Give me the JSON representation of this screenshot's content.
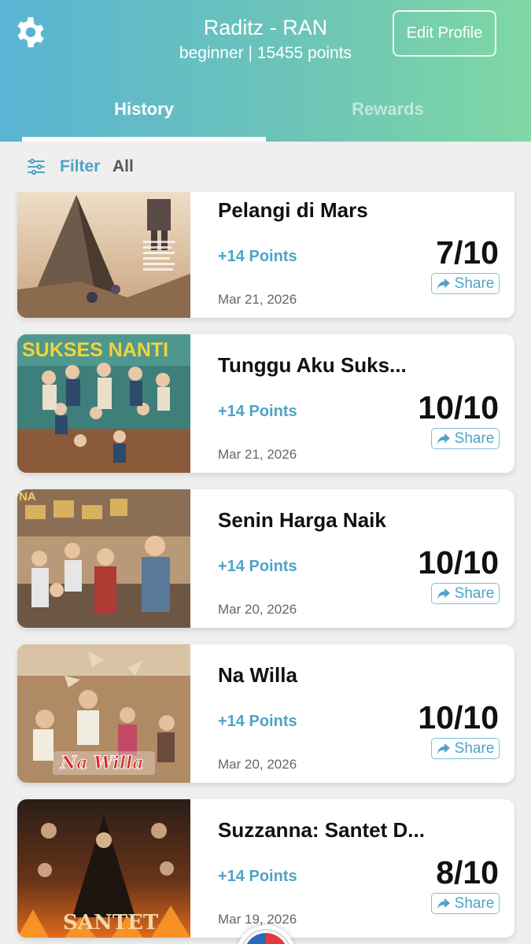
{
  "header": {
    "profile_name": "Raditz - RAN",
    "profile_sub": "beginner | 15455 points",
    "edit_label": "Edit Profile"
  },
  "tabs": [
    {
      "label": "History",
      "active": true
    },
    {
      "label": "Rewards",
      "active": false
    }
  ],
  "filter": {
    "label": "Filter",
    "value": "All"
  },
  "history": [
    {
      "title": "Pelangi di Mars",
      "points": "+14 Points",
      "date": "Mar 21, 2026",
      "score": "7/10",
      "share": "Share"
    },
    {
      "title": "Tunggu Aku Suks...",
      "points": "+14 Points",
      "date": "Mar 21, 2026",
      "score": "10/10",
      "share": "Share"
    },
    {
      "title": "Senin Harga Naik",
      "points": "+14 Points",
      "date": "Mar 20, 2026",
      "score": "10/10",
      "share": "Share"
    },
    {
      "title": "Na Willa",
      "points": "+14 Points",
      "date": "Mar 20, 2026",
      "score": "10/10",
      "share": "Share"
    },
    {
      "title": "Suzzanna: Santet D...",
      "points": "+14 Points",
      "date": "Mar 19, 2026",
      "score": "8/10",
      "share": "Share"
    }
  ],
  "posters": {
    "poster_1_text": "",
    "poster_2_text": "SUKSES NANTI",
    "poster_3_text": "NA",
    "poster_4_text": "Na Willa",
    "poster_5_text": "SANTET"
  },
  "colors": {
    "accent": "#4fa3c7",
    "header_start": "#5ab4d3",
    "header_end": "#80d8a4"
  }
}
